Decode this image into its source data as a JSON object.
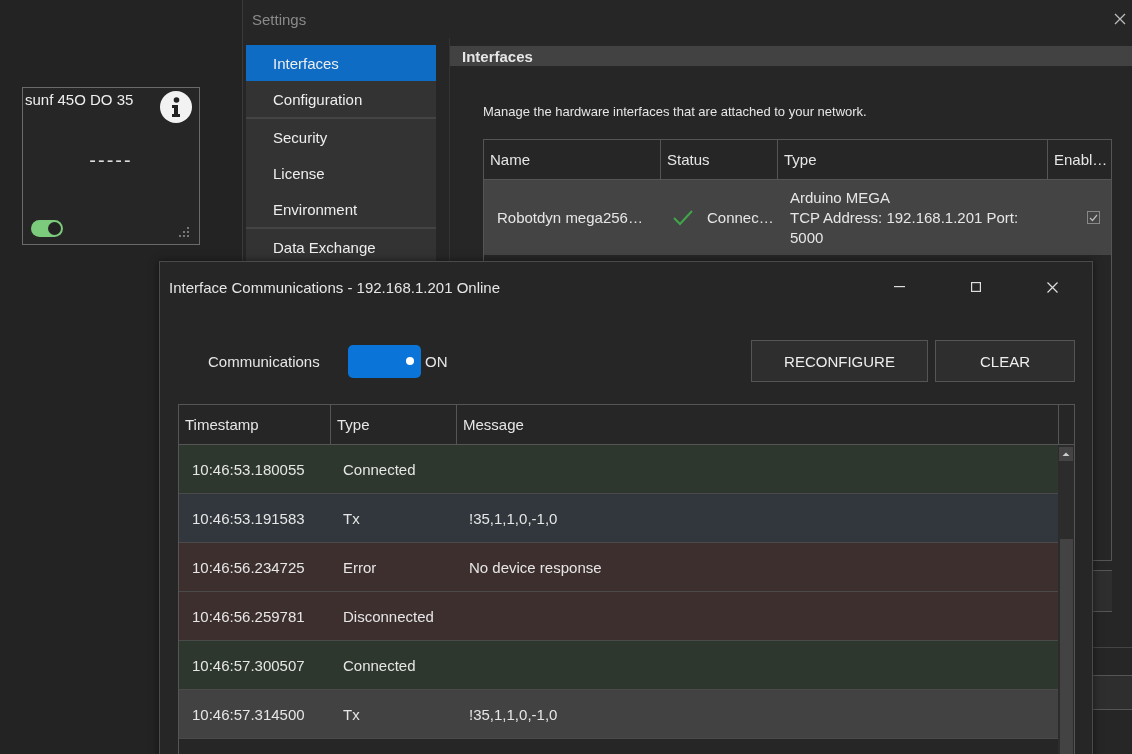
{
  "tile": {
    "title": "sunf 45O DO 35",
    "value": "-----",
    "on": true
  },
  "settings": {
    "title": "Settings",
    "nav": [
      {
        "label": "Interfaces",
        "selected": true
      },
      {
        "label": "Configuration",
        "selected": false
      },
      {
        "label": "Security",
        "selected": false
      },
      {
        "label": "License",
        "selected": false
      },
      {
        "label": "Environment",
        "selected": false
      },
      {
        "label": "Data Exchange",
        "selected": false
      }
    ],
    "section_title": "Interfaces",
    "description": "Manage the hardware interfaces that are attached to your network.",
    "table": {
      "columns": [
        "Name",
        "Status",
        "Type",
        "Enabl…"
      ],
      "rows": [
        {
          "name": "Robotdyn mega256…",
          "status": "Connec…",
          "connected": true,
          "type_name": "Arduino MEGA",
          "type_detail": "TCP Address: 192.168.1.201 Port: 5000",
          "enabled": true
        }
      ]
    }
  },
  "dialog": {
    "title": "Interface Communications - 192.168.1.201 Online",
    "comm_label": "Communications",
    "comm_on": true,
    "comm_state": "ON",
    "buttons": [
      "RECONFIGURE",
      "CLEAR"
    ],
    "log": {
      "columns": [
        "Timestamp",
        "Type",
        "Message"
      ],
      "rows": [
        {
          "timestamp": "10:46:53.180055",
          "type": "Connected",
          "kind": "connected",
          "selected": false
        },
        {
          "timestamp": "10:46:53.191583",
          "type": "Tx",
          "message": "!35,1,1,0,-1,0",
          "kind": "tx",
          "selected": false
        },
        {
          "timestamp": "10:46:56.234725",
          "type": "Error",
          "message": "No device response",
          "kind": "error",
          "selected": false
        },
        {
          "timestamp": "10:46:56.259781",
          "type": "Disconnected",
          "kind": "error",
          "selected": false
        },
        {
          "timestamp": "10:46:57.300507",
          "type": "Connected",
          "kind": "connected",
          "selected": false
        },
        {
          "timestamp": "10:46:57.314500",
          "type": "Tx",
          "message": "!35,1,1,0,-1,0",
          "kind": "tx",
          "selected": true
        }
      ]
    }
  }
}
